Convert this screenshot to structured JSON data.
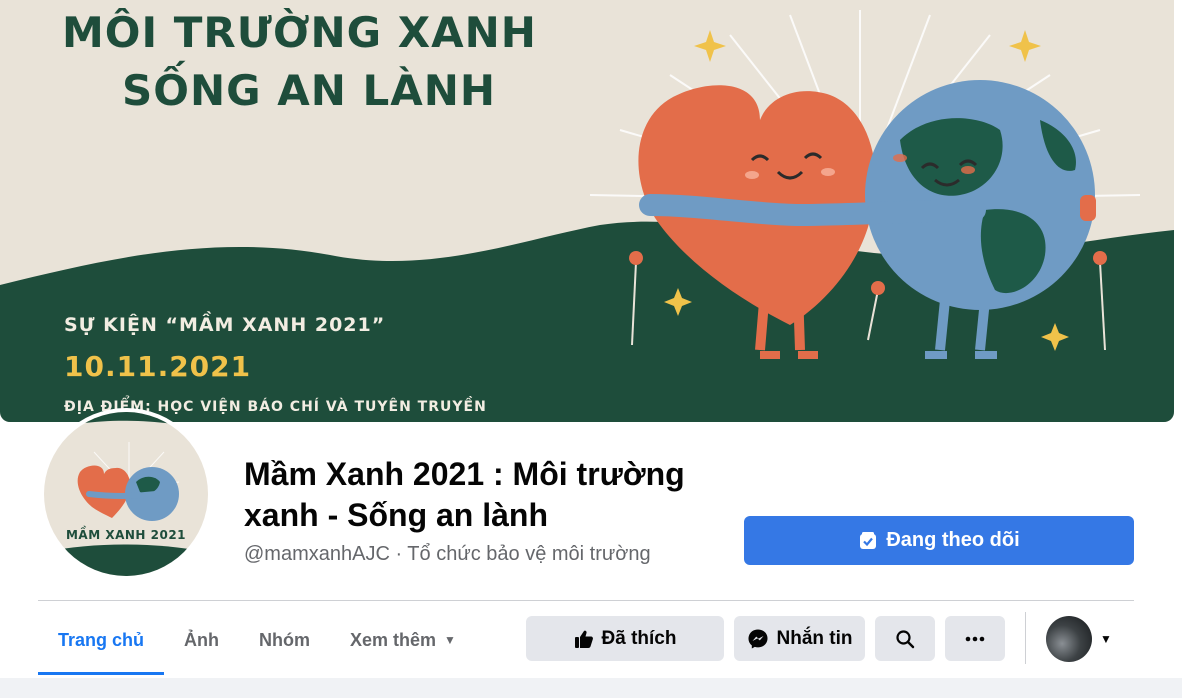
{
  "cover": {
    "title_line1": "MÔI TRƯỜNG XANH",
    "title_line2": "SỐNG AN LÀNH",
    "event_name": "SỰ KIỆN “MẦM XANH 2021”",
    "event_date": "10.11.2021",
    "event_place": "ĐỊA ĐIỂM: HỌC VIỆN BÁO CHÍ VÀ TUYÊN TRUYỀN"
  },
  "avatar": {
    "caption": "MẦM XANH 2021"
  },
  "page": {
    "name": "Mầm Xanh 2021 : Môi trường xanh - Sống an lành",
    "meta": "@mamxanhAJC · Tổ chức bảo vệ môi trường"
  },
  "follow_button": {
    "label": "Đang theo dõi",
    "icon": "followed-check-icon"
  },
  "tabs": [
    {
      "label": "Trang chủ",
      "active": true
    },
    {
      "label": "Ảnh"
    },
    {
      "label": "Nhóm"
    },
    {
      "label": "Xem thêm",
      "icon": "caret-down-icon"
    }
  ],
  "actions": {
    "liked_label": "Đã thích",
    "message_label": "Nhắn tin",
    "search_icon": "search-icon",
    "more_icon": "more-dots-icon",
    "profile_menu_icon": "caret-down-icon"
  },
  "colors": {
    "primary_blue": "#3578e5",
    "tab_active": "#1877f2",
    "cover_green": "#1e4d3b",
    "heart": "#e36d4a",
    "earth": "#6f9bc4"
  }
}
